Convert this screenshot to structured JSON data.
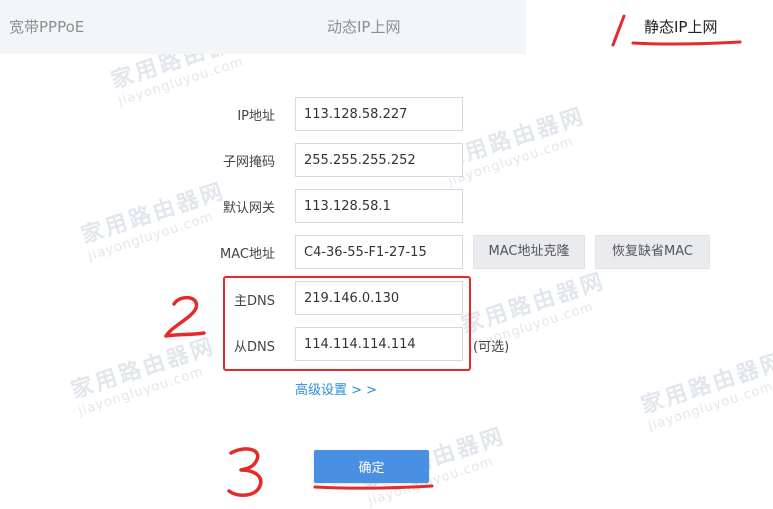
{
  "tabs": [
    {
      "label": "宽带PPPoE"
    },
    {
      "label": "动态IP上网"
    },
    {
      "label": "静态IP上网"
    }
  ],
  "form": {
    "ip_label": "IP地址",
    "ip_value": "113.128.58.227",
    "mask_label": "子网掩码",
    "mask_value": "255.255.255.252",
    "gateway_label": "默认网关",
    "gateway_value": "113.128.58.1",
    "mac_label": "MAC地址",
    "mac_value": "C4-36-55-F1-27-15",
    "mac_clone_label": "MAC地址克隆",
    "mac_restore_label": "恢复缺省MAC",
    "dns1_label": "主DNS",
    "dns1_value": "219.146.0.130",
    "dns2_label": "从DNS",
    "dns2_value": "114.114.114.114",
    "optional_note": "(可选)",
    "advanced_link": "高级设置 > >",
    "confirm_label": "确定"
  },
  "annotations": {
    "step1": "1",
    "step2": "2",
    "step3": "3",
    "color": "#e52a2a"
  },
  "watermark": {
    "text": "家用路由器网",
    "sub": "jiayongluyou.com"
  }
}
